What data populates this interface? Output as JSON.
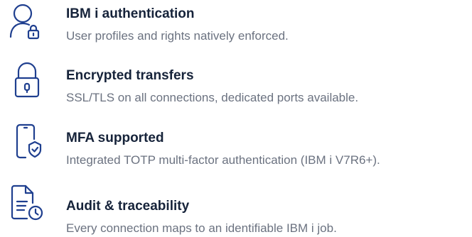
{
  "colors": {
    "icon_stroke": "#1f3f8f",
    "title": "#16233a",
    "description": "#6b7280",
    "background": "#ffffff"
  },
  "features": [
    {
      "icon": "user-lock-icon",
      "title": "IBM i authentication",
      "description": "User profiles and rights natively enforced."
    },
    {
      "icon": "padlock-icon",
      "title": "Encrypted transfers",
      "description": "SSL/TLS on all connections, dedicated ports available."
    },
    {
      "icon": "phone-shield-icon",
      "title": "MFA supported",
      "description": "Integrated TOTP multi-factor authentication (IBM i V7R6+)."
    },
    {
      "icon": "document-clock-icon",
      "title": "Audit & traceability",
      "description": "Every connection maps to an identifiable IBM i job."
    }
  ]
}
